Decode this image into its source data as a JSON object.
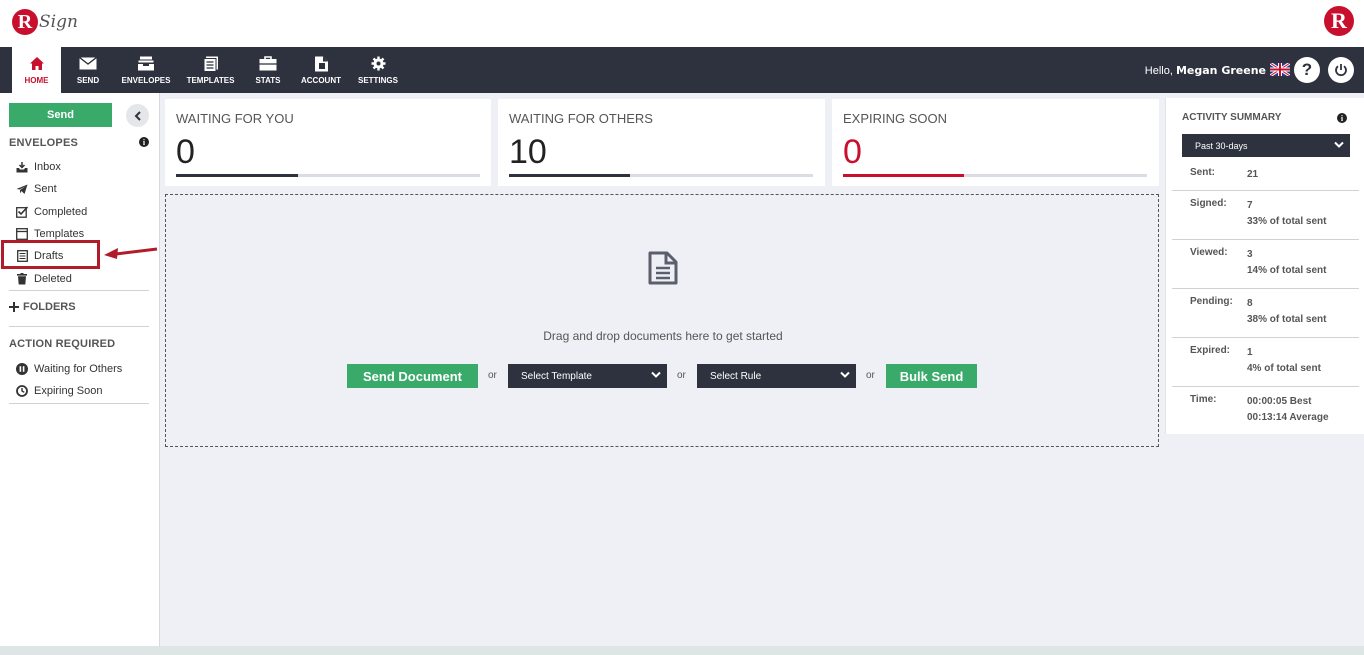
{
  "app": {
    "logo_text": "Sign"
  },
  "nav": {
    "items": [
      {
        "label": "HOME",
        "icon": "home-icon",
        "active": true
      },
      {
        "label": "SEND",
        "icon": "envelope-icon"
      },
      {
        "label": "ENVELOPES",
        "icon": "inbox-tray-icon"
      },
      {
        "label": "TEMPLATES",
        "icon": "documents-icon"
      },
      {
        "label": "STATS",
        "icon": "briefcase-icon"
      },
      {
        "label": "ACCOUNT",
        "icon": "file-icon"
      },
      {
        "label": "SETTINGS",
        "icon": "gear-icon"
      }
    ],
    "hello_prefix": "Hello,",
    "user_name": "Megan Greene",
    "help_glyph": "?",
    "power_glyph": "⏻"
  },
  "sidebar": {
    "send_label": "Send",
    "envelopes_title": "ENVELOPES",
    "info_glyph": "i",
    "envelope_items": [
      {
        "label": "Inbox",
        "icon": "inbox-icon"
      },
      {
        "label": "Sent",
        "icon": "paper-plane-icon"
      },
      {
        "label": "Completed",
        "icon": "checkbox-icon"
      },
      {
        "label": "Templates",
        "icon": "template-icon"
      },
      {
        "label": "Drafts",
        "icon": "drafts-icon"
      },
      {
        "label": "Deleted",
        "icon": "trash-icon"
      }
    ],
    "folders_label": "FOLDERS",
    "action_required_title": "ACTION REQUIRED",
    "action_items": [
      {
        "label": "Waiting for Others",
        "icon": "pause-icon"
      },
      {
        "label": "Expiring Soon",
        "icon": "clock-icon"
      }
    ]
  },
  "cards": [
    {
      "title": "WAITING FOR YOU",
      "value": "0",
      "color": "#2d323e"
    },
    {
      "title": "WAITING FOR OTHERS",
      "value": "10",
      "color": "#2d323e"
    },
    {
      "title": "EXPIRING SOON",
      "value": "0",
      "color": "#c8102e"
    }
  ],
  "dropzone": {
    "text": "Drag and drop documents here to get started",
    "send_document_label": "Send Document",
    "or_label": "or",
    "template_select": "Select Template",
    "rule_select": "Select Rule",
    "bulk_send_label": "Bulk Send"
  },
  "activity": {
    "title": "ACTIVITY SUMMARY",
    "period": "Past 30-days",
    "rows": [
      {
        "label": "Sent:",
        "lines": [
          "21"
        ]
      },
      {
        "label": "Signed:",
        "lines": [
          "7",
          "33% of total sent"
        ]
      },
      {
        "label": "Viewed:",
        "lines": [
          "3",
          "14% of total sent"
        ]
      },
      {
        "label": "Pending:",
        "lines": [
          "8",
          "38% of total sent"
        ]
      },
      {
        "label": "Expired:",
        "lines": [
          "1",
          "4% of total sent"
        ]
      },
      {
        "label": "Time:",
        "lines": [
          "00:00:05 Best",
          "00:13:14 Average"
        ]
      }
    ]
  },
  "colors": {
    "brand": "#c8102e",
    "nav_bg": "#2d323e",
    "green": "#3aaa6a",
    "highlight": "#b01c2a"
  }
}
